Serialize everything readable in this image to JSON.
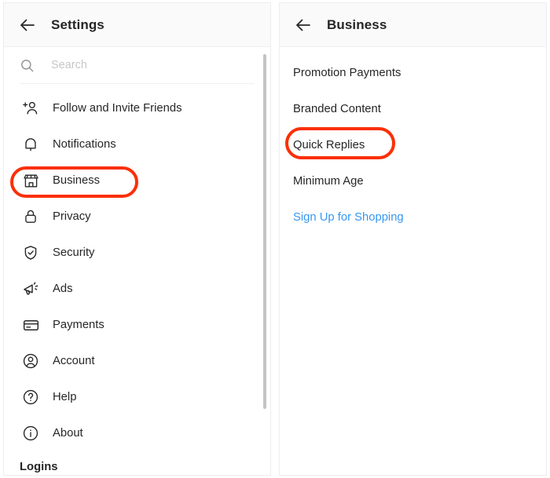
{
  "left_panel": {
    "header": {
      "back_icon": "arrow-left-icon",
      "title": "Settings"
    },
    "search": {
      "icon": "search-icon",
      "placeholder": "Search",
      "value": ""
    },
    "items": [
      {
        "label": "Follow and Invite Friends",
        "icon": "person-add-icon"
      },
      {
        "label": "Notifications",
        "icon": "bell-icon"
      },
      {
        "label": "Business",
        "icon": "storefront-icon"
      },
      {
        "label": "Privacy",
        "icon": "lock-icon"
      },
      {
        "label": "Security",
        "icon": "shield-check-icon"
      },
      {
        "label": "Ads",
        "icon": "megaphone-icon"
      },
      {
        "label": "Payments",
        "icon": "credit-card-icon"
      },
      {
        "label": "Account",
        "icon": "account-circle-icon"
      },
      {
        "label": "Help",
        "icon": "help-circle-icon"
      },
      {
        "label": "About",
        "icon": "info-circle-icon"
      }
    ],
    "section_header": "Logins",
    "highlighted_item": "Business"
  },
  "right_panel": {
    "header": {
      "back_icon": "arrow-left-icon",
      "title": "Business"
    },
    "items": [
      {
        "label": "Promotion Payments",
        "type": "normal"
      },
      {
        "label": "Branded Content",
        "type": "normal"
      },
      {
        "label": "Quick Replies",
        "type": "normal"
      },
      {
        "label": "Minimum Age",
        "type": "normal"
      },
      {
        "label": "Sign Up for Shopping",
        "type": "link"
      }
    ],
    "highlighted_item": "Quick Replies"
  },
  "colors": {
    "annotation": "#fb2f07",
    "link": "#3897f0",
    "text": "#262626",
    "placeholder": "#c7c7c7",
    "header_bg": "#fafafa",
    "border": "#efefef"
  }
}
